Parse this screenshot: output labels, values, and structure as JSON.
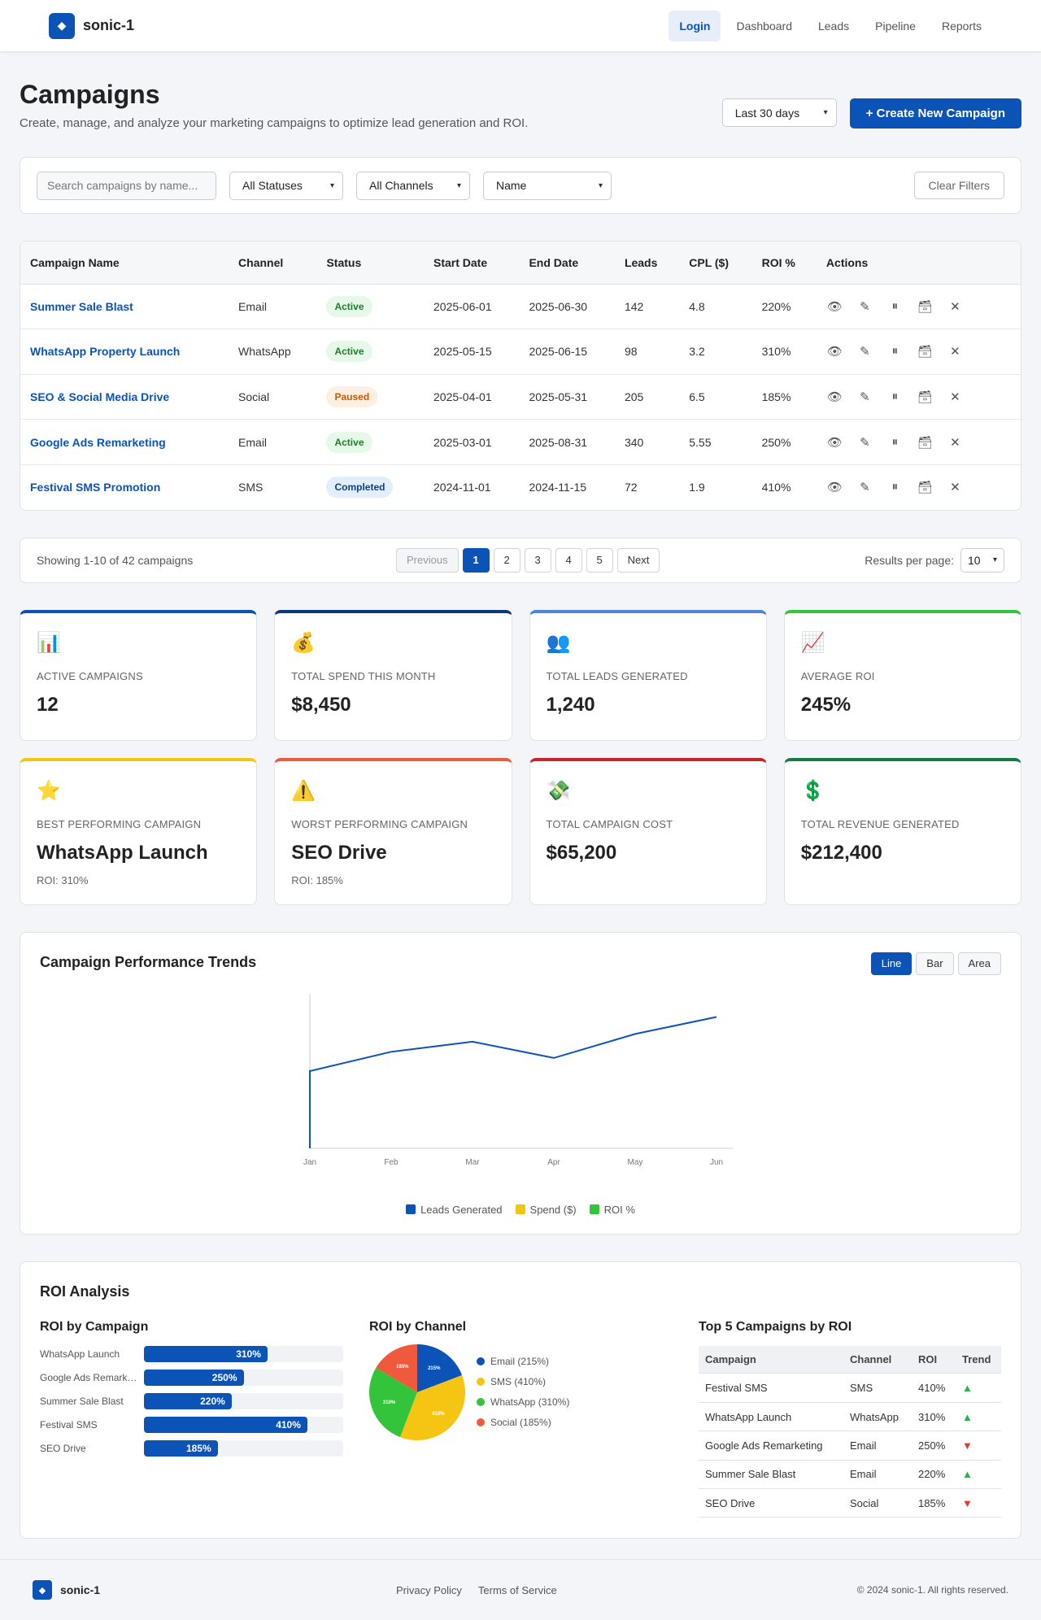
{
  "brand": {
    "name": "sonic-1",
    "logo_glyph": "◆"
  },
  "nav": {
    "items": [
      "Login",
      "Dashboard",
      "Leads",
      "Pipeline",
      "Reports"
    ],
    "active": "Login"
  },
  "header": {
    "title": "Campaigns",
    "subtitle": "Create, manage, and analyze your marketing campaigns to optimize lead generation and ROI.",
    "range_select": "Last 30 days",
    "create_button": "+ Create New Campaign"
  },
  "filters": {
    "search_placeholder": "Search campaigns by name...",
    "status": "All Statuses",
    "channel": "All Channels",
    "sort": "Name",
    "clear": "Clear Filters"
  },
  "table": {
    "columns": [
      "Campaign Name",
      "Channel",
      "Status",
      "Start Date",
      "End Date",
      "Leads",
      "CPL ($)",
      "ROI %",
      "Actions"
    ],
    "rows": [
      {
        "name": "Summer Sale Blast",
        "channel": "Email",
        "status": "Active",
        "start": "2025-06-01",
        "end": "2025-06-30",
        "leads": "142",
        "cpl": "4.8",
        "roi": "220%"
      },
      {
        "name": "WhatsApp Property Launch",
        "channel": "WhatsApp",
        "status": "Active",
        "start": "2025-05-15",
        "end": "2025-06-15",
        "leads": "98",
        "cpl": "3.2",
        "roi": "310%"
      },
      {
        "name": "SEO & Social Media Drive",
        "channel": "Social",
        "status": "Paused",
        "start": "2025-04-01",
        "end": "2025-05-31",
        "leads": "205",
        "cpl": "6.5",
        "roi": "185%"
      },
      {
        "name": "Google Ads Remarketing",
        "channel": "Email",
        "status": "Active",
        "start": "2025-03-01",
        "end": "2025-08-31",
        "leads": "340",
        "cpl": "5.55",
        "roi": "250%"
      },
      {
        "name": "Festival SMS Promotion",
        "channel": "SMS",
        "status": "Completed",
        "start": "2024-11-01",
        "end": "2024-11-15",
        "leads": "72",
        "cpl": "1.9",
        "roi": "410%"
      }
    ],
    "actions": [
      "👁",
      "✎",
      "⏸",
      "🗃",
      "✕"
    ]
  },
  "pagination": {
    "info": "Showing 1-10 of 42 campaigns",
    "previous": "Previous",
    "pages": [
      "1",
      "2",
      "3",
      "4",
      "5"
    ],
    "current": "1",
    "next": "Next",
    "per_page_label": "Results per page:",
    "per_page": "10"
  },
  "stats": [
    {
      "icon": "📊",
      "label": "Active Campaigns",
      "value": "12",
      "color": "#0b53b6"
    },
    {
      "icon": "💰",
      "label": "Total Spend This Month",
      "value": "$8,450",
      "color": "#0a3a78"
    },
    {
      "icon": "👥",
      "label": "Total Leads Generated",
      "value": "1,240",
      "color": "#4a86e0"
    },
    {
      "icon": "📈",
      "label": "Average ROI",
      "value": "245%",
      "color": "#33c43b"
    },
    {
      "icon": "⭐",
      "label": "Best Performing Campaign",
      "value": "WhatsApp Launch",
      "sub": "ROI: 310%",
      "color": "#f6c514"
    },
    {
      "icon": "⚠️",
      "label": "Worst Performing Campaign",
      "value": "SEO Drive",
      "sub": "ROI: 185%",
      "color": "#f05a3c"
    },
    {
      "icon": "💸",
      "label": "Total Campaign Cost",
      "value": "$65,200",
      "color": "#c9232b"
    },
    {
      "icon": "💲",
      "label": "Total Revenue Generated",
      "value": "$212,400",
      "color": "#147a4a"
    }
  ],
  "trend": {
    "title": "Campaign Performance Trends",
    "toggles": [
      "Line",
      "Bar",
      "Area"
    ],
    "active_toggle": "Line"
  },
  "chart_data": [
    {
      "type": "line",
      "title": "Campaign Performance Trends",
      "x": [
        "Jan",
        "Feb",
        "Mar",
        "Apr",
        "May",
        "Jun"
      ],
      "series": [
        {
          "name": "Leads Generated",
          "color": "#0b53b6",
          "values": [
            100,
            125,
            138,
            117,
            148,
            170
          ]
        },
        {
          "name": "Spend ($)",
          "color": "#f6c514",
          "values": []
        },
        {
          "name": "ROI %",
          "color": "#33c43b",
          "values": []
        }
      ],
      "ylim": [
        0,
        200
      ],
      "grid": false,
      "legend": "bottom"
    },
    {
      "type": "bar",
      "title": "ROI by Campaign",
      "categories": [
        "WhatsApp Launch",
        "Google Ads Remarketing",
        "Summer Sale Blast",
        "Festival SMS",
        "SEO Drive"
      ],
      "values": [
        310,
        250,
        220,
        410,
        185
      ],
      "xlim": [
        0,
        500
      ]
    },
    {
      "type": "pie",
      "title": "ROI by Channel",
      "categories": [
        "Email",
        "SMS",
        "WhatsApp",
        "Social"
      ],
      "values": [
        215,
        410,
        310,
        185
      ],
      "labels": [
        "215%",
        "410%",
        "310%",
        "185%"
      ],
      "legend_labels": [
        "Email (215%)",
        "SMS (410%)",
        "WhatsApp (310%)",
        "Social (185%)"
      ],
      "colors": [
        "#0b53b6",
        "#f6c514",
        "#33c43b",
        "#f05a3c"
      ]
    }
  ],
  "roi": {
    "title": "ROI Analysis",
    "by_campaign_title": "ROI by Campaign",
    "by_channel_title": "ROI by Channel",
    "top5_title": "Top 5 Campaigns by ROI",
    "top5_columns": [
      "Campaign",
      "Channel",
      "ROI",
      "Trend"
    ],
    "top5_rows": [
      {
        "campaign": "Festival SMS",
        "channel": "SMS",
        "roi": "410%",
        "trend": "▲",
        "dir": "up"
      },
      {
        "campaign": "WhatsApp Launch",
        "channel": "WhatsApp",
        "roi": "310%",
        "trend": "▲",
        "dir": "up"
      },
      {
        "campaign": "Google Ads Remarketing",
        "channel": "Email",
        "roi": "250%",
        "trend": "▼",
        "dir": "down"
      },
      {
        "campaign": "Summer Sale Blast",
        "channel": "Email",
        "roi": "220%",
        "trend": "▲",
        "dir": "up"
      },
      {
        "campaign": "SEO Drive",
        "channel": "Social",
        "roi": "185%",
        "trend": "▼",
        "dir": "down"
      }
    ]
  },
  "footer": {
    "links": [
      "Privacy Policy",
      "Terms of Service"
    ],
    "copyright": "© 2024 sonic-1. All rights reserved."
  }
}
